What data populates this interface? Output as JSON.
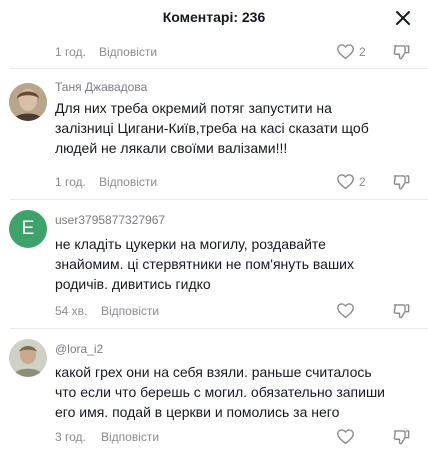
{
  "header": {
    "title": "Коментарі: 236"
  },
  "top_row": {
    "time": "1 год.",
    "reply": "Відповісти",
    "likes": "2"
  },
  "comments": [
    {
      "username": "Таня Джавадова",
      "text_lines": [
        "Для них треба окремий потяг запустити на",
        "залізниці Цигани-Київ,треба на касі сказати щоб",
        "людей не лякали своїми валізами!!!"
      ],
      "time": "1 год.",
      "reply": "Відповісти",
      "likes": "2"
    },
    {
      "username": "user3795877327967",
      "avatar_letter": "E",
      "text_lines": [
        "не кладіть цукерки на могилу, роздавайте",
        "знайомим. ці стервятники не пом'януть ваших",
        "родичів. дивитись гидко"
      ],
      "time": "54 хв.",
      "reply": "Відповісти",
      "likes": ""
    },
    {
      "username": "@lora_i2",
      "text_lines": [
        "какой грех они на себя взяли. раньше считалось",
        "что если что берешь с могил. обязательно запиши",
        "его имя. подай в церкви и помолись за него"
      ],
      "time": "3 год.",
      "reply": "Відповісти",
      "likes": ""
    }
  ],
  "colors": {
    "avatar_green": "#3ea36b",
    "muted_text": "#8a8b91"
  }
}
